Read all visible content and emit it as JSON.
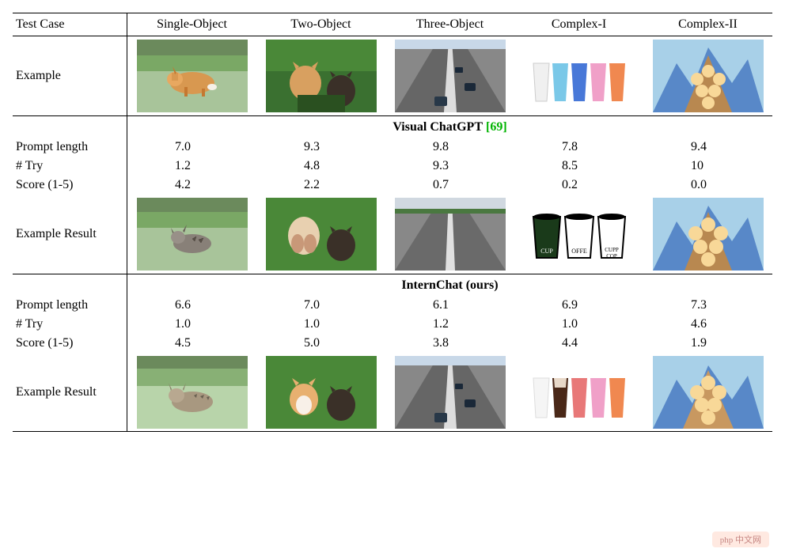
{
  "header": {
    "label": "Test Case",
    "cols": [
      "Single-Object",
      "Two-Object",
      "Three-Object",
      "Complex-I",
      "Complex-II"
    ]
  },
  "example_row_label": "Example",
  "example_result_label": "Example Result",
  "metrics": [
    "Prompt length",
    "# Try",
    "Score (1-5)"
  ],
  "sections": [
    {
      "title": "Visual ChatGPT",
      "cite": "[69]",
      "rows": [
        [
          "7.0",
          "9.3",
          "9.8",
          "7.8",
          "9.4"
        ],
        [
          "1.2",
          "4.8",
          "9.3",
          "8.5",
          "10"
        ],
        [
          "4.2",
          "2.2",
          "0.7",
          "0.2",
          "0.0"
        ]
      ]
    },
    {
      "title": "InternChat (ours)",
      "cite": "",
      "rows": [
        [
          "6.6",
          "7.0",
          "6.1",
          "6.9",
          "7.3"
        ],
        [
          "1.0",
          "1.0",
          "1.2",
          "1.0",
          "4.6"
        ],
        [
          "4.5",
          "5.0",
          "3.8",
          "4.4",
          "1.9"
        ]
      ]
    }
  ],
  "watermark": "php 中文网"
}
